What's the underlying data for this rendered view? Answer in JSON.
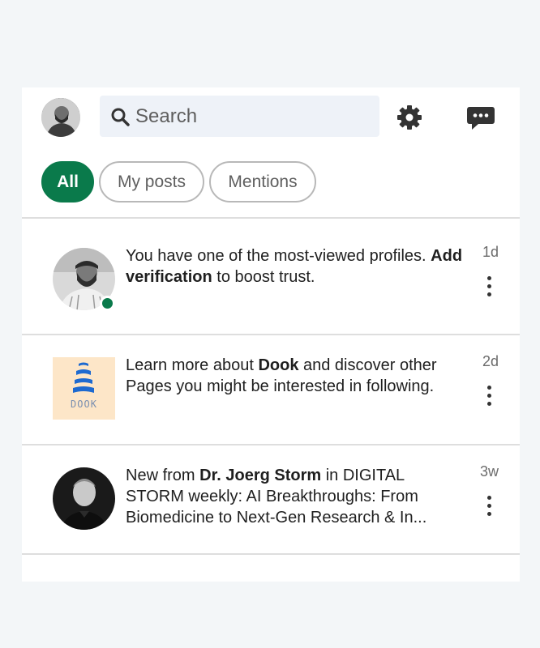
{
  "header": {
    "search_placeholder": "Search",
    "icons": {
      "settings": "gear-icon",
      "messages": "chat-bubble-icon",
      "search": "search-icon"
    }
  },
  "filters": [
    {
      "label": "All",
      "active": true
    },
    {
      "label": "My posts",
      "active": false
    },
    {
      "label": "Mentions",
      "active": false
    }
  ],
  "notifications": [
    {
      "pre": "You have one of the most-viewed profiles. ",
      "bold": "Add verification",
      "post": " to boost trust.",
      "time": "1d"
    },
    {
      "pre": "Learn more about ",
      "bold": "Dook",
      "post": " and discover other Pages you might be interested in following.",
      "time": "2d",
      "logo_text": "DOOK"
    },
    {
      "pre": "New from ",
      "bold": "Dr. Joerg Storm",
      "post": " in DIGITAL STORM weekly: AI Breakthroughs: From Biomedicine to Next-Gen Research & In...",
      "time": "3w"
    }
  ],
  "colors": {
    "accent": "#0a7a4b",
    "search_bg": "#eef2f8",
    "page_bg": "#f3f6f8"
  }
}
